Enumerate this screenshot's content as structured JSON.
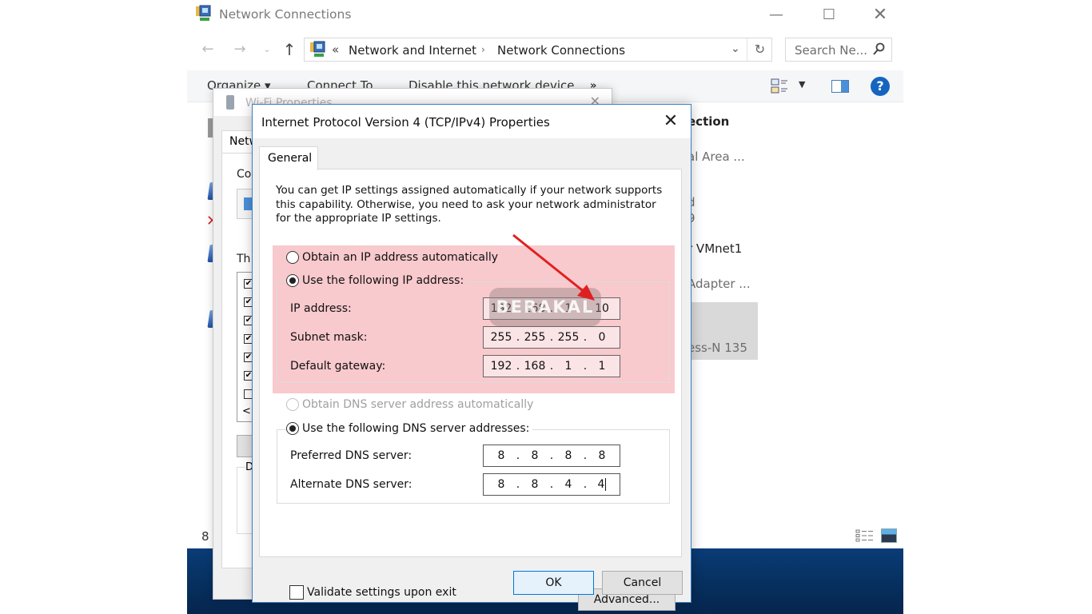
{
  "explorer": {
    "title": "Network Connections",
    "window_controls": {
      "minimize": "—",
      "maximize": "☐",
      "close": "✕"
    },
    "nav": {
      "back": "←",
      "forward": "→",
      "history": "⌄",
      "up": "↑"
    },
    "address": {
      "chevron": "«",
      "crumbs": [
        "Network and Internet",
        "Network Connections"
      ],
      "separator": "›",
      "dropdown": "⌄",
      "refresh": "↻"
    },
    "search": {
      "placeholder": "Search Ne..."
    },
    "commands": {
      "organize": "Organize ▾",
      "connect_to": "Connect To",
      "disable": "Disable this network device",
      "more": "»",
      "view_dropdown": "▼",
      "help": "?"
    },
    "list_fragments": [
      {
        "text": "ection",
        "style": "bold"
      },
      {
        "text": "al Area ...",
        "style": "gray"
      },
      {
        "text": "d",
        "style": "gray"
      },
      {
        "text": "9",
        "style": "gray"
      },
      {
        "text": "r VMnet1",
        "style": "normal"
      },
      {
        "text": "Adapter ...",
        "style": "gray"
      },
      {
        "text": "ess-N 135",
        "style": "gray"
      }
    ],
    "status": {
      "item_count": "8"
    }
  },
  "wifi_dialog": {
    "title": "Wi-Fi Properties",
    "tab": "Netw",
    "connect_using_fragment": "Co",
    "items_fragment": "Th",
    "scroll_left": "<",
    "description_fragment": "D",
    "checkbox_states": [
      true,
      true,
      true,
      true,
      true,
      true,
      false
    ]
  },
  "ipv4_dialog": {
    "title": "Internet Protocol Version 4 (TCP/IPv4) Properties",
    "close": "✕",
    "tab": "General",
    "intro": "You can get IP settings assigned automatically if your network supports this capability. Otherwise, you need to ask your network administrator for the appropriate IP settings.",
    "ip_mode": {
      "auto_label": "Obtain an IP address automatically",
      "manual_label": "Use the following IP address:",
      "selected": "manual"
    },
    "ip_fields": [
      {
        "label": "IP address:",
        "octets": [
          "192",
          "168",
          "1",
          "10"
        ]
      },
      {
        "label": "Subnet mask:",
        "octets": [
          "255",
          "255",
          "255",
          "0"
        ]
      },
      {
        "label": "Default gateway:",
        "octets": [
          "192",
          "168",
          "1",
          "1"
        ]
      }
    ],
    "dns_mode": {
      "auto_label": "Obtain DNS server address automatically",
      "manual_label": "Use the following DNS server addresses:",
      "selected": "manual",
      "auto_disabled": true
    },
    "dns_fields": [
      {
        "label": "Preferred DNS server:",
        "octets": [
          "8",
          "8",
          "8",
          "8"
        ]
      },
      {
        "label": "Alternate DNS server:",
        "octets": [
          "8",
          "8",
          "4",
          "4"
        ]
      }
    ],
    "validate_label": "Validate settings upon exit",
    "validate_checked": false,
    "advanced_label": "Advanced...",
    "ok_label": "OK",
    "cancel_label": "Cancel"
  },
  "annotations": {
    "watermark": "BERAKAL",
    "highlight_color": "#f8c9cd",
    "arrow_color": "#e02020"
  }
}
